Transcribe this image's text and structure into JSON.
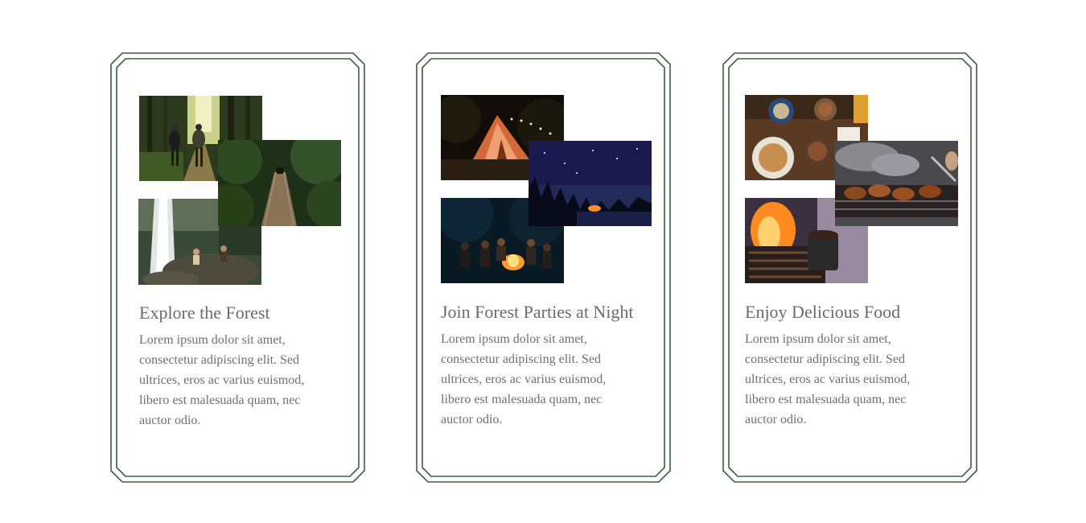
{
  "cards": [
    {
      "title": "Explore the Forest",
      "text": "Lorem ipsum dolor sit amet, consectetur adipiscing elit. Sed ultrices, eros ac varius euismod, libero est malesuada quam, nec auctor odio.",
      "photos": [
        "forest-hikers-photo",
        "rope-bridge-photo",
        "waterfall-photo"
      ]
    },
    {
      "title": "Join Forest Parties at Night",
      "text": "Lorem ipsum dolor sit amet, consectetur adipiscing elit. Sed ultrices, eros ac varius euismod, libero est malesuada quam, nec auctor odio.",
      "photos": [
        "night-tent-photo",
        "starry-sky-photo",
        "campfire-group-photo"
      ]
    },
    {
      "title": "Enjoy Delicious Food",
      "text": "Lorem ipsum dolor sit amet, consectetur adipiscing elit. Sed ultrices, eros ac varius euismod, libero est malesuada quam, nec auctor odio.",
      "photos": [
        "breakfast-table-photo",
        "bbq-grill-photo",
        "fire-coffee-photo"
      ]
    }
  ],
  "colors": {
    "frame": "#3d5e40",
    "heading": "#6a6a6a",
    "body_text": "#6f6f6f"
  }
}
